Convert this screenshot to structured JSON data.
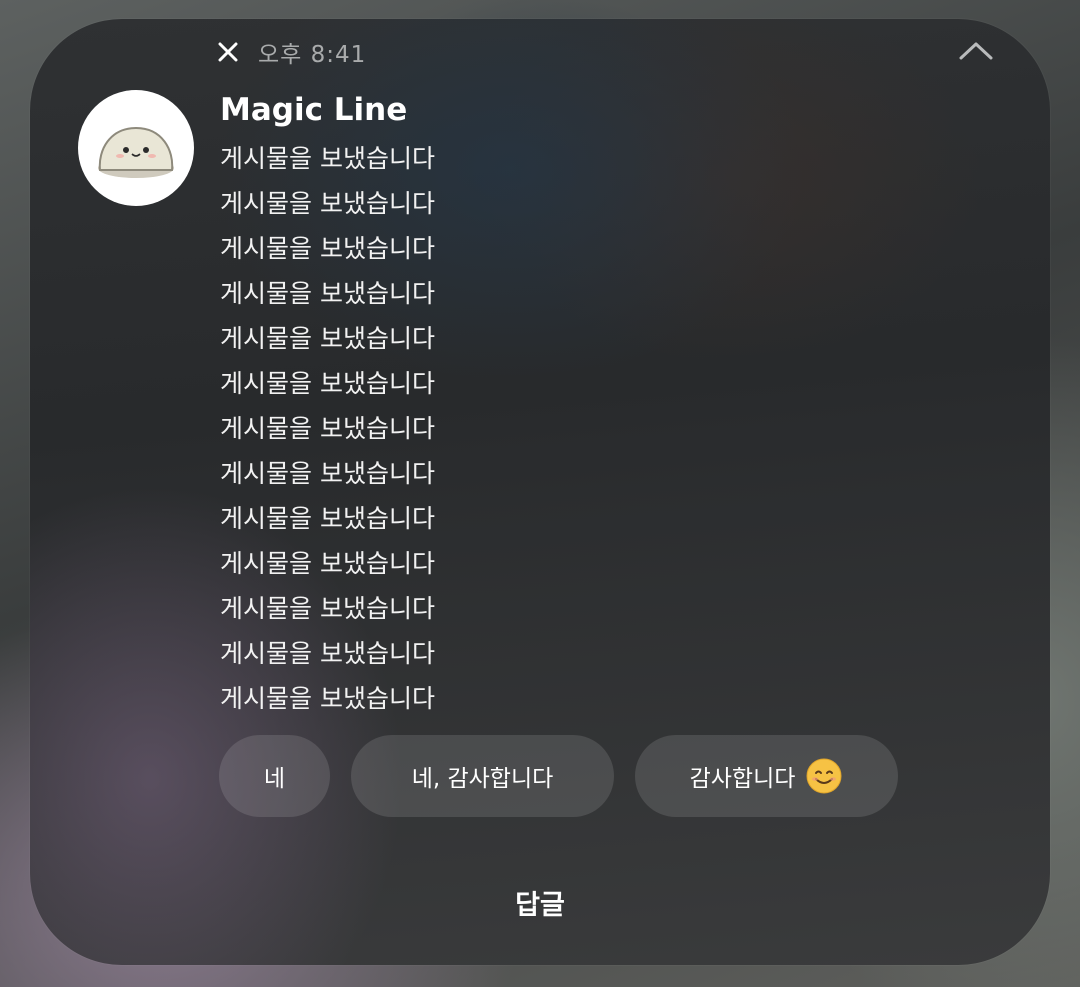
{
  "notification": {
    "app_icon": "x-logo-icon",
    "time": "오후 8:41",
    "collapse_icon": "chevron-up-icon",
    "avatar": "mochi-character-avatar",
    "sender": "Magic Line",
    "messages": [
      "게시물을 보냈습니다",
      "게시물을 보냈습니다",
      "게시물을 보냈습니다",
      "게시물을 보냈습니다",
      "게시물을 보냈습니다",
      "게시물을 보냈습니다",
      "게시물을 보냈습니다",
      "게시물을 보냈습니다",
      "게시물을 보냈습니다",
      "게시물을 보냈습니다",
      "게시물을 보냈습니다",
      "게시물을 보냈습니다",
      "게시물을 보냈습니다"
    ],
    "quick_replies": [
      {
        "label": "네"
      },
      {
        "label": "네, 감사합니다"
      },
      {
        "label": "감사합니다",
        "emoji": "smiling-face-icon"
      }
    ],
    "reply_label": "답글"
  },
  "colors": {
    "text_primary": "#ffffff",
    "text_secondary": "#a9abac",
    "chip_background": "rgba(255,255,255,0.12)"
  }
}
